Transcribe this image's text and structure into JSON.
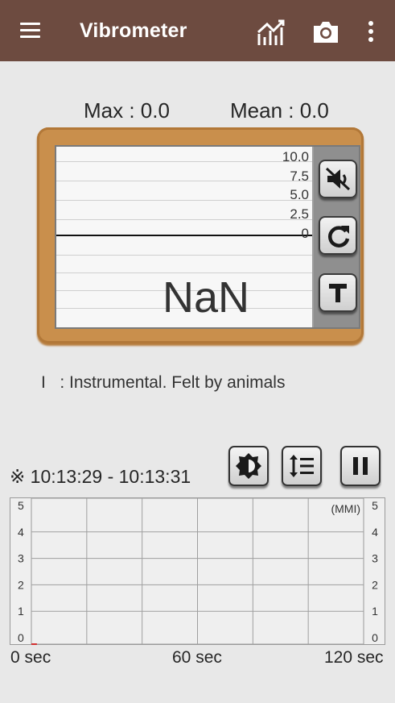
{
  "app_bar": {
    "title": "Vibrometer",
    "menu_icon": "hamburger-menu-icon",
    "actions": [
      "chart-trend-icon",
      "camera-icon",
      "more-vert-icon"
    ],
    "background": "#6d4b40"
  },
  "stats": {
    "max": "Max : 0.0",
    "mean": "Mean : 0.0"
  },
  "meter": {
    "y_ticks": [
      "10.0",
      "7.5",
      "5.0",
      "2.5",
      "0"
    ],
    "reading": "NaN",
    "buttons": [
      "mute-icon",
      "refresh-icon",
      "text-T-icon"
    ]
  },
  "intensity": {
    "level": "I",
    "description": ": Instrumental. Felt by animals"
  },
  "history": {
    "time_range": "※ 10:13:29 - 10:13:31",
    "buttons": [
      "brightness-icon",
      "line-spacing-icon",
      "pause-icon"
    ]
  },
  "chart_data": {
    "type": "line",
    "ylabel": "(MMI)",
    "ylim": [
      0,
      5
    ],
    "y_ticks": [
      "5",
      "4",
      "3",
      "2",
      "1",
      "0"
    ],
    "x_ticks": [
      "0 sec",
      "60 sec",
      "120 sec"
    ],
    "xlim": [
      0,
      120
    ],
    "grid": true,
    "series": [
      {
        "x": [
          0,
          2
        ],
        "values": [
          0,
          0
        ],
        "color": "#d32f2f"
      }
    ]
  }
}
